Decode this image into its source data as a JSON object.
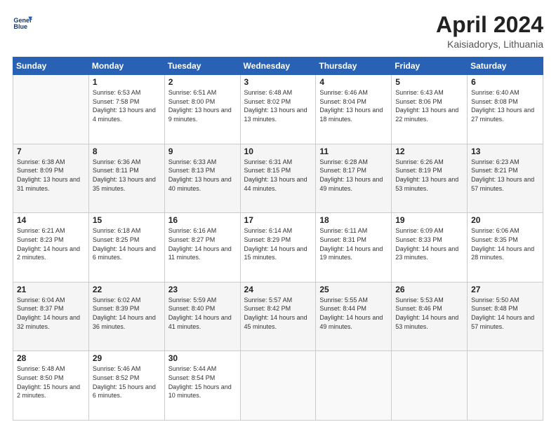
{
  "header": {
    "logo_line1": "General",
    "logo_line2": "Blue",
    "title": "April 2024",
    "subtitle": "Kaisiadorys, Lithuania"
  },
  "weekdays": [
    "Sunday",
    "Monday",
    "Tuesday",
    "Wednesday",
    "Thursday",
    "Friday",
    "Saturday"
  ],
  "weeks": [
    [
      {
        "day": "",
        "empty": true
      },
      {
        "day": "1",
        "sunrise": "6:53 AM",
        "sunset": "7:58 PM",
        "daylight": "13 hours and 4 minutes."
      },
      {
        "day": "2",
        "sunrise": "6:51 AM",
        "sunset": "8:00 PM",
        "daylight": "13 hours and 9 minutes."
      },
      {
        "day": "3",
        "sunrise": "6:48 AM",
        "sunset": "8:02 PM",
        "daylight": "13 hours and 13 minutes."
      },
      {
        "day": "4",
        "sunrise": "6:46 AM",
        "sunset": "8:04 PM",
        "daylight": "13 hours and 18 minutes."
      },
      {
        "day": "5",
        "sunrise": "6:43 AM",
        "sunset": "8:06 PM",
        "daylight": "13 hours and 22 minutes."
      },
      {
        "day": "6",
        "sunrise": "6:40 AM",
        "sunset": "8:08 PM",
        "daylight": "13 hours and 27 minutes."
      }
    ],
    [
      {
        "day": "7",
        "sunrise": "6:38 AM",
        "sunset": "8:09 PM",
        "daylight": "13 hours and 31 minutes."
      },
      {
        "day": "8",
        "sunrise": "6:36 AM",
        "sunset": "8:11 PM",
        "daylight": "13 hours and 35 minutes."
      },
      {
        "day": "9",
        "sunrise": "6:33 AM",
        "sunset": "8:13 PM",
        "daylight": "13 hours and 40 minutes."
      },
      {
        "day": "10",
        "sunrise": "6:31 AM",
        "sunset": "8:15 PM",
        "daylight": "13 hours and 44 minutes."
      },
      {
        "day": "11",
        "sunrise": "6:28 AM",
        "sunset": "8:17 PM",
        "daylight": "13 hours and 49 minutes."
      },
      {
        "day": "12",
        "sunrise": "6:26 AM",
        "sunset": "8:19 PM",
        "daylight": "13 hours and 53 minutes."
      },
      {
        "day": "13",
        "sunrise": "6:23 AM",
        "sunset": "8:21 PM",
        "daylight": "13 hours and 57 minutes."
      }
    ],
    [
      {
        "day": "14",
        "sunrise": "6:21 AM",
        "sunset": "8:23 PM",
        "daylight": "14 hours and 2 minutes."
      },
      {
        "day": "15",
        "sunrise": "6:18 AM",
        "sunset": "8:25 PM",
        "daylight": "14 hours and 6 minutes."
      },
      {
        "day": "16",
        "sunrise": "6:16 AM",
        "sunset": "8:27 PM",
        "daylight": "14 hours and 11 minutes."
      },
      {
        "day": "17",
        "sunrise": "6:14 AM",
        "sunset": "8:29 PM",
        "daylight": "14 hours and 15 minutes."
      },
      {
        "day": "18",
        "sunrise": "6:11 AM",
        "sunset": "8:31 PM",
        "daylight": "14 hours and 19 minutes."
      },
      {
        "day": "19",
        "sunrise": "6:09 AM",
        "sunset": "8:33 PM",
        "daylight": "14 hours and 23 minutes."
      },
      {
        "day": "20",
        "sunrise": "6:06 AM",
        "sunset": "8:35 PM",
        "daylight": "14 hours and 28 minutes."
      }
    ],
    [
      {
        "day": "21",
        "sunrise": "6:04 AM",
        "sunset": "8:37 PM",
        "daylight": "14 hours and 32 minutes."
      },
      {
        "day": "22",
        "sunrise": "6:02 AM",
        "sunset": "8:39 PM",
        "daylight": "14 hours and 36 minutes."
      },
      {
        "day": "23",
        "sunrise": "5:59 AM",
        "sunset": "8:40 PM",
        "daylight": "14 hours and 41 minutes."
      },
      {
        "day": "24",
        "sunrise": "5:57 AM",
        "sunset": "8:42 PM",
        "daylight": "14 hours and 45 minutes."
      },
      {
        "day": "25",
        "sunrise": "5:55 AM",
        "sunset": "8:44 PM",
        "daylight": "14 hours and 49 minutes."
      },
      {
        "day": "26",
        "sunrise": "5:53 AM",
        "sunset": "8:46 PM",
        "daylight": "14 hours and 53 minutes."
      },
      {
        "day": "27",
        "sunrise": "5:50 AM",
        "sunset": "8:48 PM",
        "daylight": "14 hours and 57 minutes."
      }
    ],
    [
      {
        "day": "28",
        "sunrise": "5:48 AM",
        "sunset": "8:50 PM",
        "daylight": "15 hours and 2 minutes."
      },
      {
        "day": "29",
        "sunrise": "5:46 AM",
        "sunset": "8:52 PM",
        "daylight": "15 hours and 6 minutes."
      },
      {
        "day": "30",
        "sunrise": "5:44 AM",
        "sunset": "8:54 PM",
        "daylight": "15 hours and 10 minutes."
      },
      {
        "day": "",
        "empty": true
      },
      {
        "day": "",
        "empty": true
      },
      {
        "day": "",
        "empty": true
      },
      {
        "day": "",
        "empty": true
      }
    ]
  ],
  "labels": {
    "sunrise": "Sunrise:",
    "sunset": "Sunset:",
    "daylight": "Daylight:"
  }
}
